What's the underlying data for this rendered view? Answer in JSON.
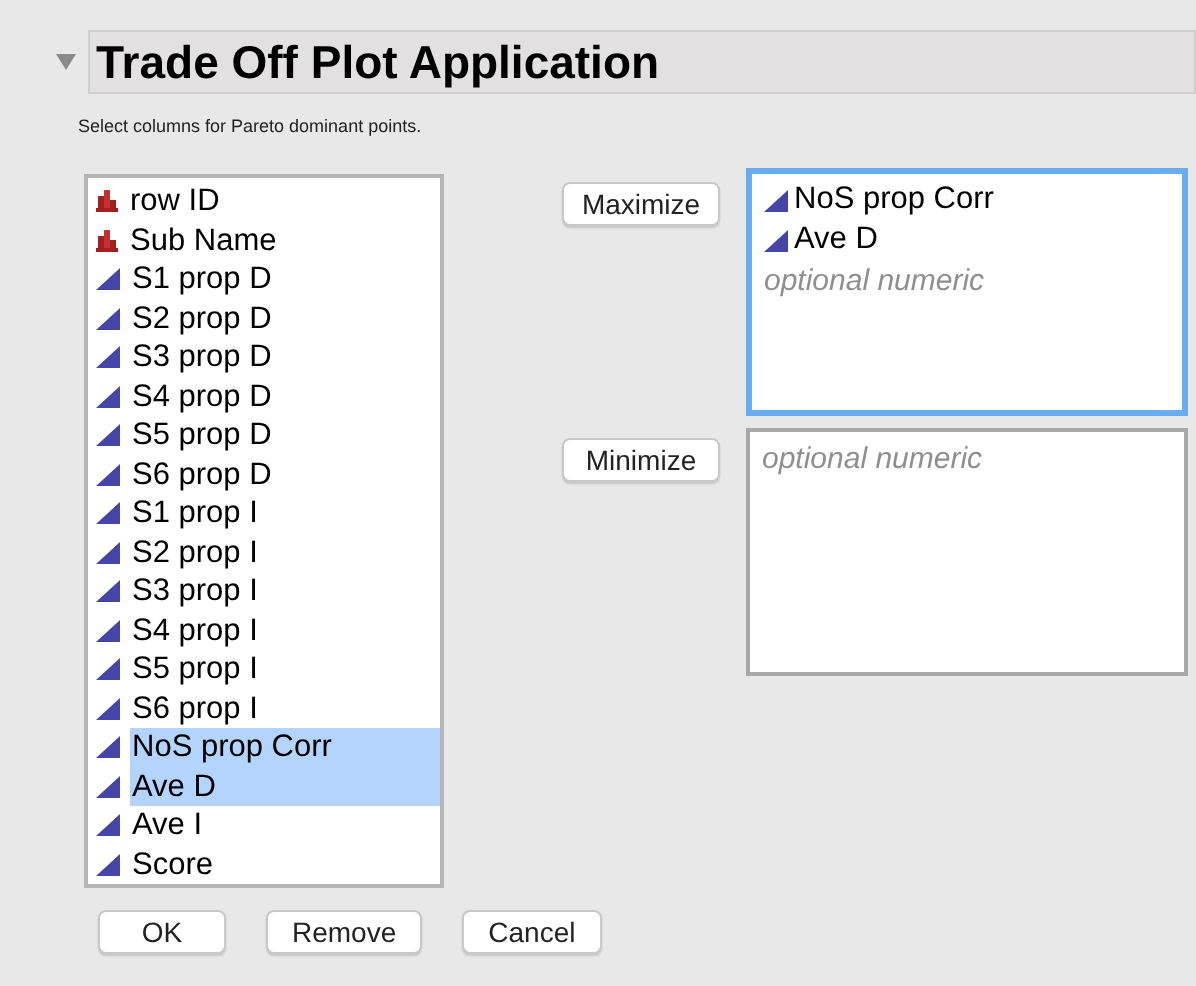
{
  "outline": {
    "title": "Trade Off Plot Application",
    "expanded": true,
    "subtitle": "Select columns for Pareto dominant points."
  },
  "columns": [
    {
      "name": "row ID",
      "kind": "nominal",
      "selected": false
    },
    {
      "name": "Sub Name",
      "kind": "nominal",
      "selected": false
    },
    {
      "name": "S1 prop D",
      "kind": "continuous",
      "selected": false
    },
    {
      "name": "S2 prop D",
      "kind": "continuous",
      "selected": false
    },
    {
      "name": "S3 prop D",
      "kind": "continuous",
      "selected": false
    },
    {
      "name": "S4 prop D",
      "kind": "continuous",
      "selected": false
    },
    {
      "name": "S5 prop D",
      "kind": "continuous",
      "selected": false
    },
    {
      "name": "S6 prop D",
      "kind": "continuous",
      "selected": false
    },
    {
      "name": "S1 prop I",
      "kind": "continuous",
      "selected": false
    },
    {
      "name": "S2 prop I",
      "kind": "continuous",
      "selected": false
    },
    {
      "name": "S3 prop I",
      "kind": "continuous",
      "selected": false
    },
    {
      "name": "S4 prop I",
      "kind": "continuous",
      "selected": false
    },
    {
      "name": "S5 prop I",
      "kind": "continuous",
      "selected": false
    },
    {
      "name": "S6 prop I",
      "kind": "continuous",
      "selected": false
    },
    {
      "name": "NoS prop Corr",
      "kind": "continuous",
      "selected": true
    },
    {
      "name": "Ave D",
      "kind": "continuous",
      "selected": true
    },
    {
      "name": "Ave I",
      "kind": "continuous",
      "selected": false
    },
    {
      "name": "Score",
      "kind": "continuous",
      "selected": false
    }
  ],
  "roles": [
    {
      "button": "Maximize",
      "focused": true,
      "items": [
        {
          "name": "NoS prop Corr",
          "kind": "continuous"
        },
        {
          "name": "Ave D",
          "kind": "continuous"
        }
      ],
      "placeholder": "optional numeric"
    },
    {
      "button": "Minimize",
      "focused": false,
      "placeholder": "optional numeric"
    }
  ],
  "buttons": [
    "OK",
    "Remove",
    "Cancel"
  ]
}
